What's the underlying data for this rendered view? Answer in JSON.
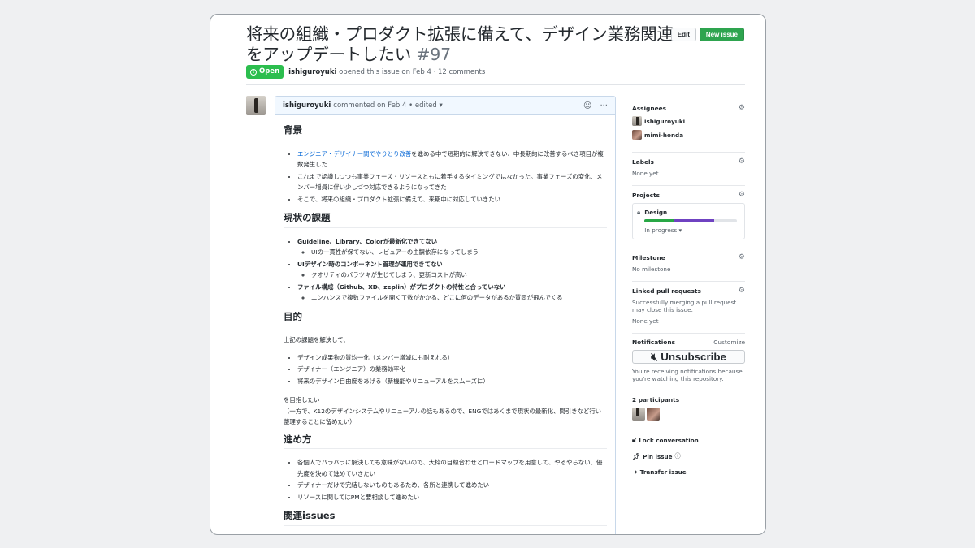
{
  "issue": {
    "title": "将来の組織・プロダクト拡張に備えて、デザイン業務関連をアップデートしたい",
    "number": "#97",
    "status": "Open",
    "author": "ishiguroyuki",
    "meta_text": "opened this issue on Feb 4 · 12 comments"
  },
  "header": {
    "edit_label": "Edit",
    "new_issue_label": "New issue"
  },
  "comment": {
    "author": "ishiguroyuki",
    "meta": "commented on Feb 4 • edited ▾",
    "sections": {
      "background": {
        "heading": "背景",
        "item1_link": "エンジニア・デザイナー間でやりとり改善",
        "item1_rest": "を進める中で短期的に解決できない、中長期的に改善するべき項目が複数発生した",
        "item2": "これまで認識しつつも事業フェーズ・リソースともに着手するタイミングではなかった。事業フェーズの変化、メンバー増員に伴い少しづつ対応できるようになってきた",
        "item3": "そこで、将来の組織・プロダクト拡張に備えて、来期中に対応していきたい"
      },
      "issues": {
        "heading": "現状の課題",
        "i1": "Guideline、Library、Colorが最新化できてない",
        "i1_sub": "UIの一貫性が保てない、レビュアーの主観依存になってしまう",
        "i2": "UIデザイン時のコンポーネント管理が運用できてない",
        "i2_sub": "クオリティのバラツキが生じてしまう、更新コストが高い",
        "i3": "ファイル構成（Github、XD、zeplin）がプロダクトの特性と合っていない",
        "i3_sub": "エンハンスで複数ファイルを開く工数がかかる、どこに何のデータがあるか質問が飛んでくる"
      },
      "purpose": {
        "heading": "目的",
        "intro": "上記の課題を解決して、",
        "p1": "デザイン成果物の質均一化（メンバー増減にも耐えれる）",
        "p2": "デザイナー（エンジニア）の業務効率化",
        "p3": "将来のデザイン自由度をあげる（新機能やリニューアルをスムーズに）",
        "outro1": "を目指したい",
        "outro2": "（一方で、K12のデザインシステムやリニューアルの話もあるので、ENGではあくまで現状の最新化、間引きなど行い整理することに留めたい）"
      },
      "approach": {
        "heading": "進め方",
        "a1": "各個人でバラバラに解決しても意味がないので、大枠の目線合わせとロードマップを用意して、やるやらない、優先度を決めて進めていきたい",
        "a2": "デザイナーだけで完結しないものもあるため、各所と連携して進めたい",
        "a3": "リソースに関してはPMと要相談して進めたい"
      },
      "related": {
        "heading": "関連issues"
      }
    }
  },
  "sidebar": {
    "assignees": {
      "label": "Assignees",
      "users": [
        "ishiguroyuki",
        "mimi-honda"
      ]
    },
    "labels": {
      "label": "Labels",
      "value": "None yet"
    },
    "projects": {
      "label": "Projects",
      "name": "Design",
      "status": "In progress ▾",
      "done_fraction": 0.32,
      "in_progress_fraction": 0.43
    },
    "milestone": {
      "label": "Milestone",
      "value": "No milestone"
    },
    "linked_prs": {
      "label": "Linked pull requests",
      "text": "Successfully merging a pull request may close this issue.",
      "value": "None yet"
    },
    "notifications": {
      "label": "Notifications",
      "customize": "Customize",
      "button": "Unsubscribe",
      "text": "You're receiving notifications because you're watching this repository."
    },
    "participants": {
      "label": "2 participants"
    },
    "actions": {
      "lock": "Lock conversation",
      "pin": "Pin issue",
      "transfer": "Transfer issue"
    }
  },
  "colors": {
    "open_green": "#2cbe4e",
    "link_blue": "#0366d6",
    "progress_green": "#28a745",
    "progress_purple": "#6f42c1"
  }
}
